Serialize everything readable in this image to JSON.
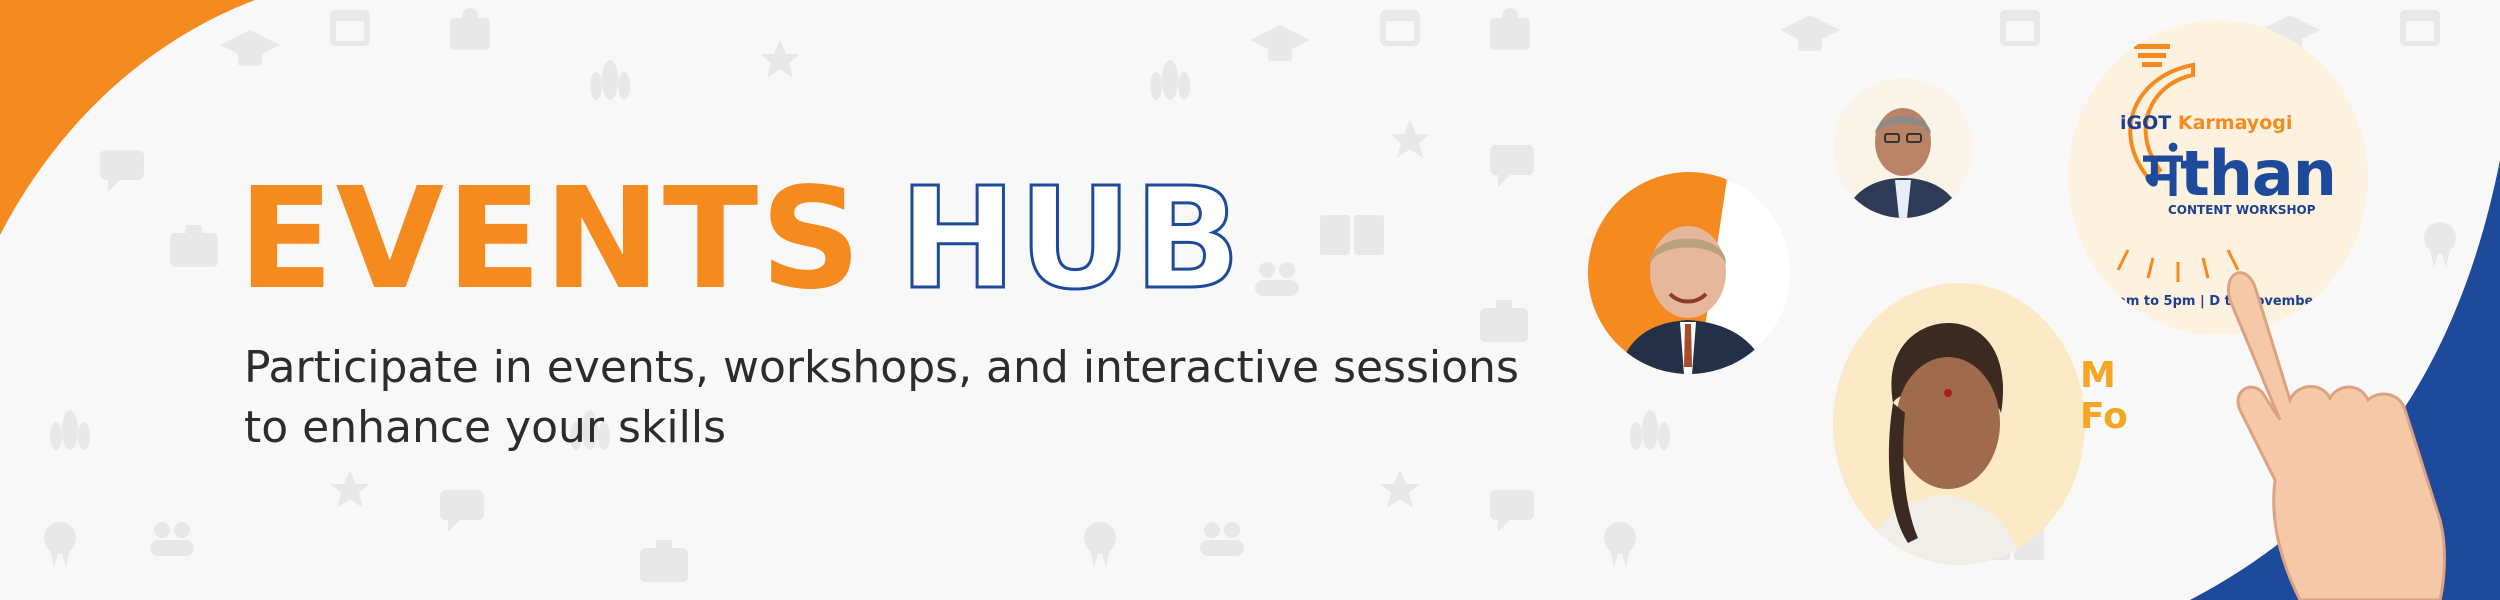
{
  "banner": {
    "title_primary": "EVENTS",
    "title_secondary": "HUB",
    "subtitle": "Participate in events, workshops, and interactive sessions to enhance your skills",
    "colors": {
      "orange": "#f58a1f",
      "blue": "#1d4a9b",
      "text": "#2c2c2c",
      "background": "#f8f8f8"
    }
  },
  "poster": {
    "brand_igot": "iGOT",
    "brand_karmayogi": "Karmayogi",
    "word": "मंthan",
    "subtitle": "CONTENT WORKSHOP",
    "schedule_partial": "0am to 5pm | D     th November"
  },
  "woman_card_text": {
    "line1": "M",
    "line2": "Fo"
  },
  "icons": [
    "graduation-cap-icon",
    "calendar-icon",
    "puzzle-icon",
    "lotus-icon",
    "star-icon",
    "chat-icon",
    "briefcase-icon",
    "book-icon",
    "award-icon",
    "users-icon"
  ]
}
